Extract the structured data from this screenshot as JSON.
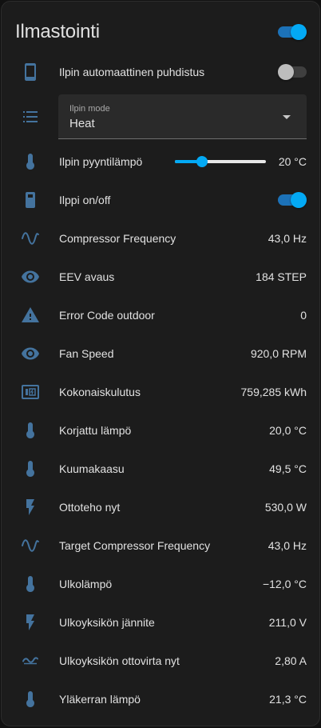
{
  "card": {
    "title": "Ilmastointi",
    "master_toggle": true
  },
  "rows": {
    "auto_clean": {
      "label": "Ilpin automaattinen puhdistus",
      "on": false,
      "icon": "tablet-icon"
    },
    "mode": {
      "field_label": "Ilpin mode",
      "selected": "Heat",
      "icon": "list-icon"
    },
    "target_temp": {
      "label": "Ilpin pyyntilämpö",
      "value": "20 °C",
      "level": 0.3,
      "icon": "thermometer-icon"
    },
    "power": {
      "label": "Ilppi on/off",
      "on": true,
      "icon": "remote-icon"
    },
    "compressor_freq": {
      "label": "Compressor Frequency",
      "value": "43,0 Hz",
      "icon": "sine-wave-icon"
    },
    "eev": {
      "label": "EEV avaus",
      "value": "184 STEP",
      "icon": "eye-icon"
    },
    "error_code": {
      "label": "Error Code outdoor",
      "value": "0",
      "icon": "alert-icon"
    },
    "fan_speed": {
      "label": "Fan Speed",
      "value": "920,0 RPM",
      "icon": "eye-icon"
    },
    "total_energy": {
      "label": "Kokonaiskulutus",
      "value": "759,285 kWh",
      "icon": "meter-icon"
    },
    "corrected_temp": {
      "label": "Korjattu lämpö",
      "value": "20,0 °C",
      "icon": "thermometer-icon"
    },
    "hot_gas": {
      "label": "Kuumakaasu",
      "value": "49,5 °C",
      "icon": "thermometer-icon"
    },
    "power_now": {
      "label": "Ottoteho nyt",
      "value": "530,0 W",
      "icon": "flash-icon"
    },
    "target_compressor_freq": {
      "label": "Target Compressor Frequency",
      "value": "43,0 Hz",
      "icon": "sine-wave-icon"
    },
    "outdoor_temp": {
      "label": "Ulkolämpö",
      "value": "−12,0 °C",
      "icon": "thermometer-icon"
    },
    "outdoor_voltage": {
      "label": "Ulkoyksikön jännite",
      "value": "211,0 V",
      "icon": "flash-icon"
    },
    "outdoor_current": {
      "label": "Ulkoyksikön ottovirta nyt",
      "value": "2,80 A",
      "icon": "current-ac-icon"
    },
    "upstairs_temp": {
      "label": "Yläkerran lämpö",
      "value": "21,3 °C",
      "icon": "thermometer-icon"
    }
  },
  "colors": {
    "card_bg": "#1c1c1c",
    "icon": "#44739e",
    "accent": "#03a9f4",
    "text": "#e1e1e1"
  }
}
